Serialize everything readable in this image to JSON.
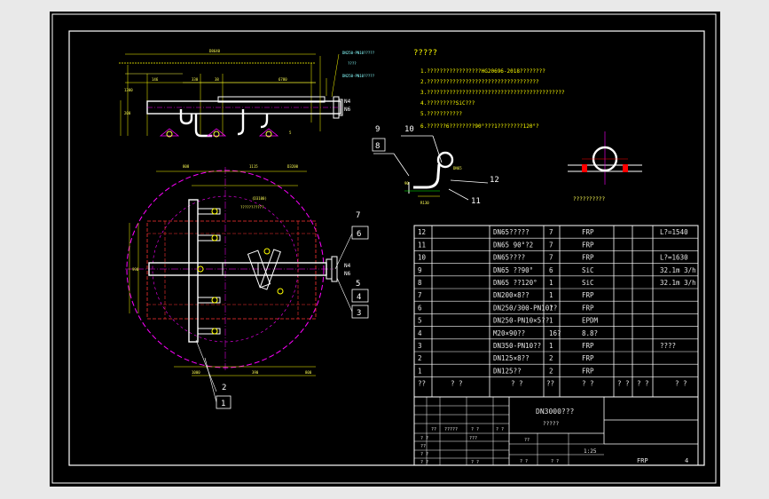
{
  "notes": {
    "title": "?????",
    "items": [
      "1.?????????????????HG20696-2018????????",
      "2.???????????????????????????????????",
      "3.???????????????????????????????????????????",
      "4.?????????SiC???",
      "5.???????????",
      "6.??????6????????90°???1????????120°?"
    ]
  },
  "detail_caption": "??????????",
  "part_table": {
    "rows": [
      {
        "no": "12",
        "name": "DN65?????",
        "qty": "7",
        "mat": "FRP",
        "note": "L?=1540"
      },
      {
        "no": "11",
        "name": "DN65 90°?2",
        "qty": "7",
        "mat": "FRP",
        "note": ""
      },
      {
        "no": "10",
        "name": "DN65????",
        "qty": "7",
        "mat": "FRP",
        "note": "L?=1630"
      },
      {
        "no": "9",
        "name": "DN65 ??90°",
        "qty": "6",
        "mat": "SiC",
        "note": "32.1m 3/h"
      },
      {
        "no": "8",
        "name": "DN65 ??120°",
        "qty": "1",
        "mat": "SiC",
        "note": "32.1m 3/h"
      },
      {
        "no": "7",
        "name": "DN200×8??",
        "qty": "1",
        "mat": "FRP",
        "note": ""
      },
      {
        "no": "6",
        "name": "DN250/300-PN10??",
        "qty": "1",
        "mat": "FRP",
        "note": ""
      },
      {
        "no": "5",
        "name": "DN250-PN10×5??",
        "qty": "1",
        "mat": "EPDM",
        "note": ""
      },
      {
        "no": "4",
        "name": "M20×90??",
        "qty": "16?",
        "mat": "8.8?",
        "note": ""
      },
      {
        "no": "3",
        "name": "DN350-PN10??",
        "qty": "1",
        "mat": "FRP",
        "note": "????"
      },
      {
        "no": "2",
        "name": "DN125×8??",
        "qty": "2",
        "mat": "FRP",
        "note": ""
      },
      {
        "no": "1",
        "name": "DN125??",
        "qty": "2",
        "mat": "FRP",
        "note": ""
      }
    ],
    "header": {
      "no": "??",
      "code": "? ?",
      "name": "? ?",
      "qty": "??",
      "mat": "? ?",
      "unit": "? ?",
      "total": "? ?",
      "note": "? ?",
      "single": "? ?"
    }
  },
  "title_block": {
    "drawing_name": "DN3000???",
    "drawing_sub": "?????",
    "scale": "1:25",
    "material": "FRP",
    "sheet_no": "4",
    "cells": [
      "? ?",
      "??",
      "?????",
      "? ?",
      "? ?",
      "???",
      "? ?",
      "??",
      "? ?",
      "? ?",
      "? ?",
      "? ?",
      "??"
    ]
  },
  "callouts": {
    "top_view": [
      "9",
      "10",
      "8",
      "12",
      "11"
    ],
    "plan_view": [
      "7",
      "6",
      "5",
      "4",
      "3",
      "2",
      "1"
    ],
    "nozzle_labels": [
      "N4",
      "N6"
    ]
  }
}
